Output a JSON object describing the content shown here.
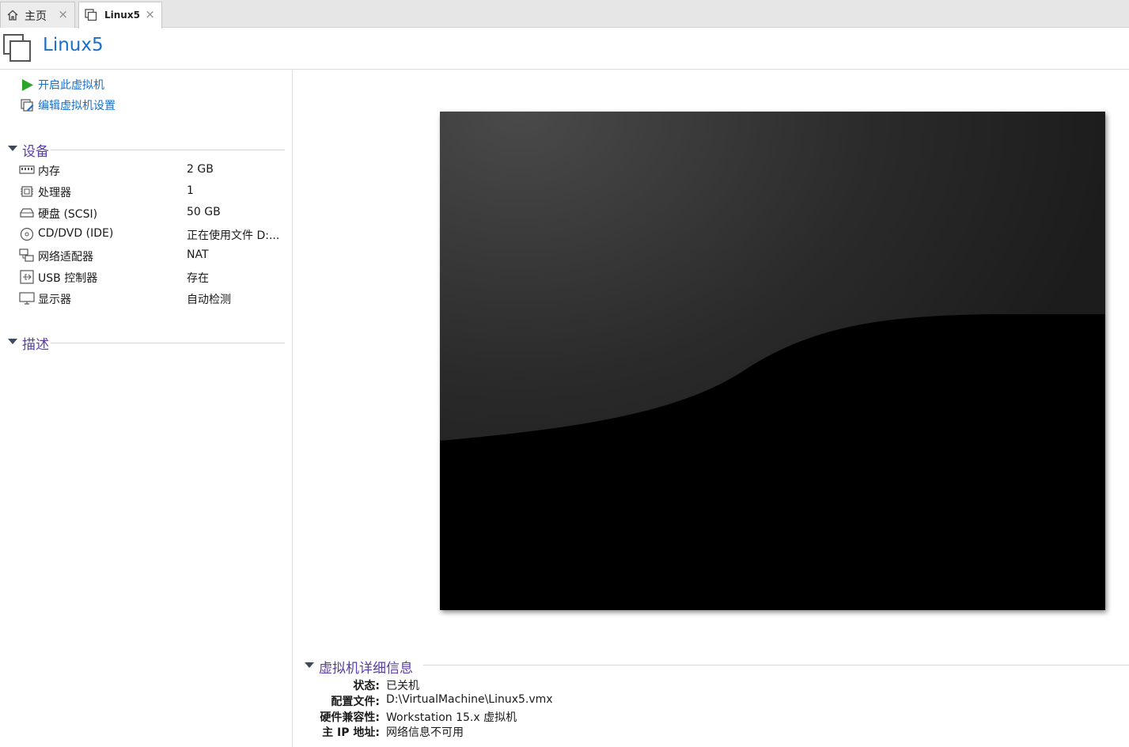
{
  "tabs": [
    {
      "label": "主页",
      "icon": "home-icon",
      "close": "×"
    },
    {
      "label": "Linux5",
      "icon": "vm-icon",
      "close": "×"
    }
  ],
  "header": {
    "title": "Linux5",
    "icon": "vm-icon"
  },
  "actions": [
    {
      "label": "开启此虚拟机",
      "icon": "play-icon"
    },
    {
      "label": "编辑虚拟机设置",
      "icon": "edit-settings-icon"
    }
  ],
  "devices_section": {
    "title": "设备"
  },
  "devices": [
    {
      "name": "内存",
      "value": "2 GB",
      "icon": "memory-icon"
    },
    {
      "name": "处理器",
      "value": "1",
      "icon": "processor-icon"
    },
    {
      "name": "硬盘 (SCSI)",
      "value": "50 GB",
      "icon": "hard-disk-icon"
    },
    {
      "name": "CD/DVD (IDE)",
      "value": "正在使用文件 D:...",
      "icon": "cd-dvd-icon"
    },
    {
      "name": "网络适配器",
      "value": "NAT",
      "icon": "network-adapter-icon"
    },
    {
      "name": "USB 控制器",
      "value": "存在",
      "icon": "usb-icon"
    },
    {
      "name": "显示器",
      "value": "自动检测",
      "icon": "display-icon"
    }
  ],
  "description_section": {
    "title": "描述"
  },
  "details": {
    "title": "虚拟机详细信息",
    "rows": [
      {
        "key": "状态:",
        "value": "已关机"
      },
      {
        "key": "配置文件:",
        "value": "D:\\VirtualMachine\\Linux5.vmx"
      },
      {
        "key": "硬件兼容性:",
        "value": "Workstation 15.x 虚拟机"
      },
      {
        "key": "主 IP 地址:",
        "value": "网络信息不可用"
      }
    ]
  },
  "colors": {
    "accent": "#1a6fc7",
    "section_title": "#5b3fa8",
    "play": "#2aa52a"
  }
}
